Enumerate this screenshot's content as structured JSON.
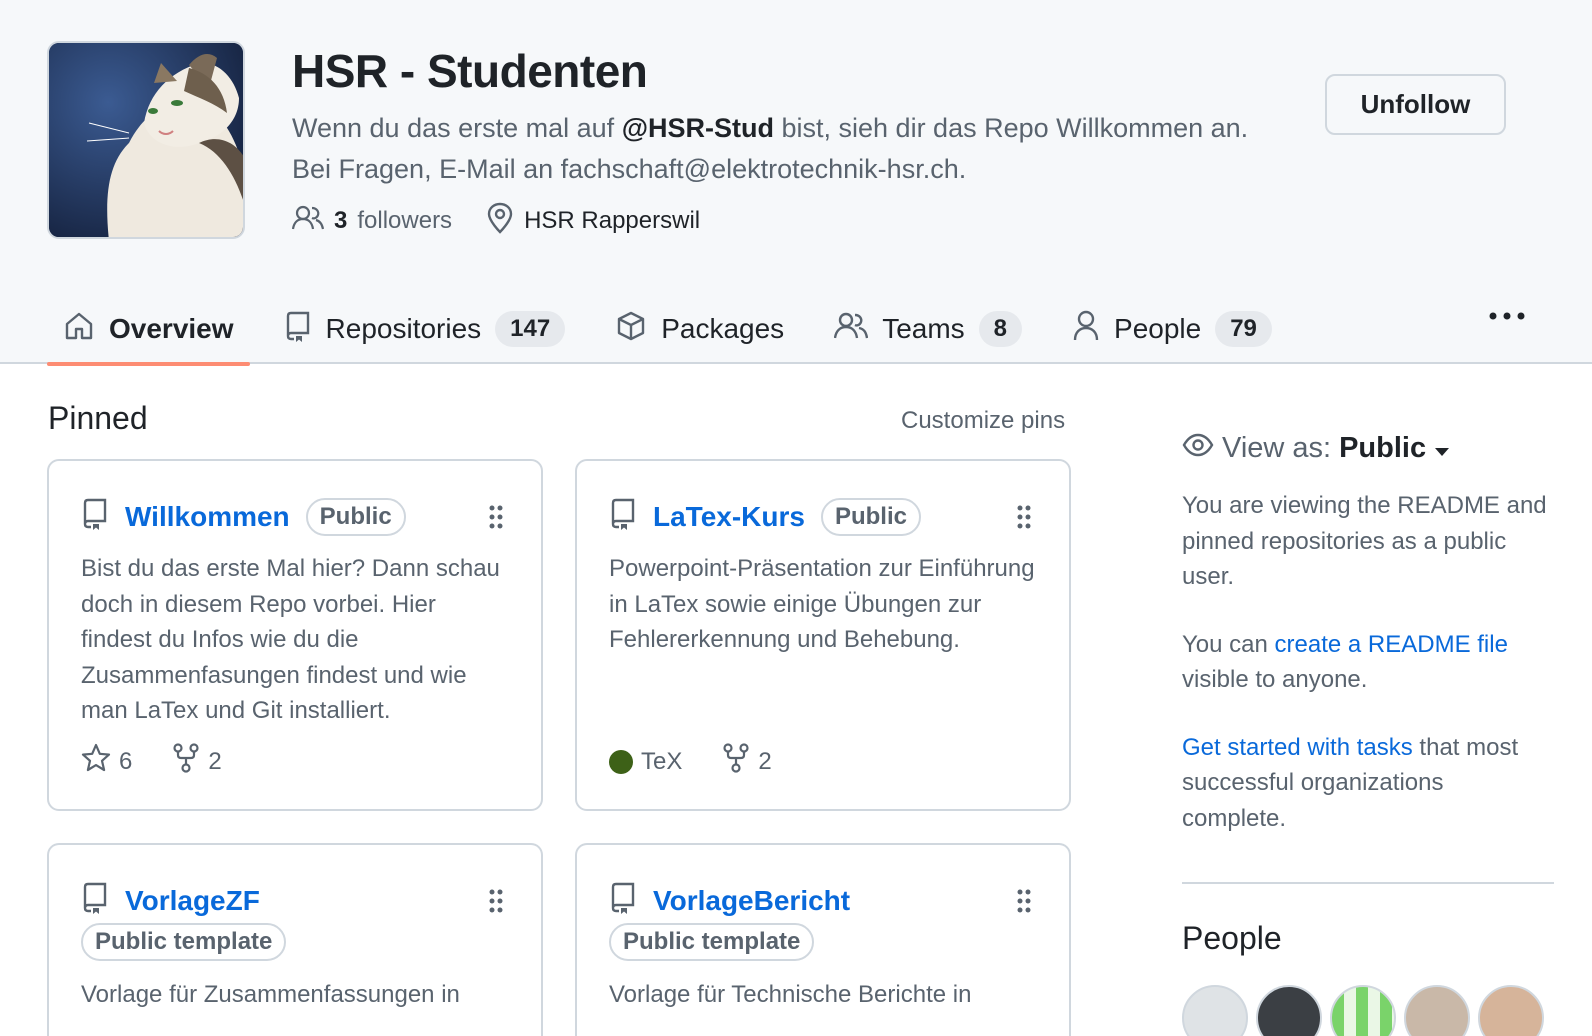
{
  "org": {
    "name": "HSR - Studenten",
    "desc_part1": "Wenn du das erste mal auf ",
    "desc_mention": "@HSR-Stud",
    "desc_part2": " bist, sieh dir das Repo Willkommen an.",
    "desc_line2": "Bei Fragen, E-Mail an fachschaft@elektrotechnik-hsr.ch.",
    "followers_count": "3",
    "followers_label": "followers",
    "location": "HSR Rapperswil",
    "unfollow_label": "Unfollow"
  },
  "tabs": [
    {
      "label": "Overview",
      "icon": "home-icon",
      "selected": true
    },
    {
      "label": "Repositories",
      "icon": "repo-icon",
      "count": "147"
    },
    {
      "label": "Packages",
      "icon": "package-icon"
    },
    {
      "label": "Teams",
      "icon": "people-icon",
      "count": "8"
    },
    {
      "label": "People",
      "icon": "person-icon",
      "count": "79"
    }
  ],
  "pinned": {
    "title": "Pinned",
    "customize_label": "Customize pins",
    "cards": [
      {
        "name": "Willkommen",
        "visibility": "Public",
        "description": "Bist du das erste Mal hier? Dann schau doch in diesem Repo vorbei. Hier findest du Infos wie du die Zusammenfasungen findest und wie man LaTex und Git installiert.",
        "stars": "6",
        "forks": "2"
      },
      {
        "name": "LaTex-Kurs",
        "visibility": "Public",
        "description": "Powerpoint-Präsentation zur Einführung in LaTex sowie einige Übungen zur Fehlererkennung und Behebung.",
        "language": "TeX",
        "language_color": "#3d6117",
        "forks": "2"
      },
      {
        "name": "VorlageZF",
        "visibility": "Public template",
        "description": "Vorlage für Zusammenfassungen in"
      },
      {
        "name": "VorlageBericht",
        "visibility": "Public template",
        "description": "Vorlage für Technische Berichte in"
      }
    ]
  },
  "sidebar": {
    "view_as_label": "View as:",
    "view_as_value": "Public",
    "readme_note": "You are viewing the README and pinned repositories as a public user.",
    "can_text": "You can ",
    "create_readme_link": "create a README file",
    "visible_text": " visible to anyone.",
    "get_started_link": "Get started with tasks",
    "get_started_rest": " that most successful organizations complete.",
    "people_title": "People"
  },
  "colors": {
    "accent_link": "#0969da",
    "tab_underline": "#fd8c73",
    "header_bg": "#f6f8fa"
  }
}
